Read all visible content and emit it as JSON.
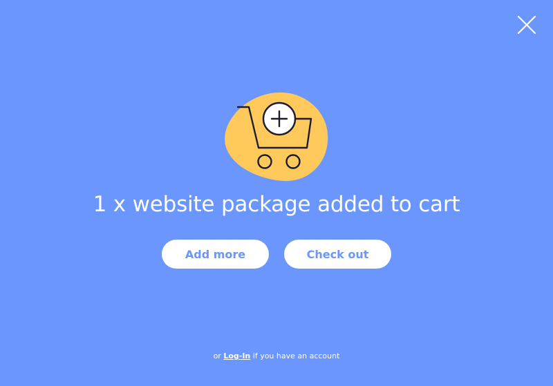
{
  "headline": "1 x website package added to cart",
  "actions": {
    "add_more_label": "Add more",
    "checkout_label": "Check out"
  },
  "footer": {
    "prefix": "or",
    "login_link": "Log-In",
    "suffix": "if you have an account"
  },
  "icons": {
    "close": "close-icon",
    "cart": "cart-add-icon"
  },
  "colors": {
    "background": "#6b96fe",
    "accent_blob": "#ffc95c",
    "button_bg": "#ffffff",
    "button_text": "#6b96fe",
    "text": "#ffffff",
    "icon_stroke": "#1c1c2e"
  }
}
